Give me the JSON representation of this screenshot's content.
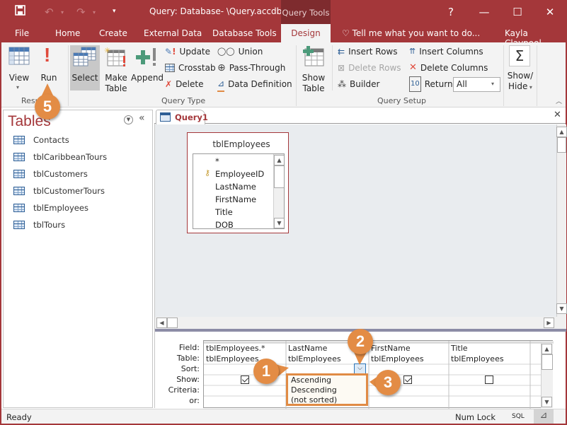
{
  "titlebar": {
    "title": "Query: Database- \\Query.accdb...",
    "context_tab": "Query Tools",
    "help": "?",
    "minimize": "—",
    "maximize": "☐",
    "close": "✕"
  },
  "tabs": [
    {
      "label": "File"
    },
    {
      "label": "Home"
    },
    {
      "label": "Create"
    },
    {
      "label": "External Data"
    },
    {
      "label": "Database Tools"
    },
    {
      "label": "Design",
      "active": true
    }
  ],
  "tell_me": "Tell me what you want to do...",
  "user": "Kayla Claypool",
  "ribbon": {
    "results": {
      "label": "Results",
      "view": "View",
      "run": "Run"
    },
    "query_type": {
      "label": "Query Type",
      "select": "Select",
      "make_table_1": "Make",
      "make_table_2": "Table",
      "append": "Append",
      "update": "Update",
      "crosstab": "Crosstab",
      "delete": "Delete",
      "union": "Union",
      "pass_through": "Pass-Through",
      "data_definition": "Data Definition"
    },
    "query_setup": {
      "label": "Query Setup",
      "show_table_1": "Show",
      "show_table_2": "Table",
      "insert_rows": "Insert Rows",
      "delete_rows": "Delete Rows",
      "builder": "Builder",
      "insert_columns": "Insert Columns",
      "delete_columns": "Delete Columns",
      "return_label": "Return:",
      "return_value": "All"
    },
    "show_hide": {
      "label_1": "Show/",
      "label_2": "Hide"
    }
  },
  "nav": {
    "title": "Tables",
    "items": [
      {
        "label": "Contacts"
      },
      {
        "label": "tblCaribbeanTours"
      },
      {
        "label": "tblCustomers"
      },
      {
        "label": "tblCustomerTours"
      },
      {
        "label": "tblEmployees"
      },
      {
        "label": "tblTours"
      }
    ]
  },
  "document": {
    "tab": "Query1",
    "field_list": {
      "title": "tblEmployees",
      "fields": [
        "*",
        "EmployeeID",
        "LastName",
        "FirstName",
        "Title",
        "DOB"
      ],
      "primary_key": "EmployeeID"
    }
  },
  "design_grid": {
    "row_labels": [
      "Field:",
      "Table:",
      "Sort:",
      "Show:",
      "Criteria:",
      "or:"
    ],
    "columns": [
      {
        "field": "tblEmployees.*",
        "table": "tblEmployees",
        "sort": "",
        "show": true
      },
      {
        "field": "LastName",
        "table": "tblEmployees",
        "sort": "",
        "show": null
      },
      {
        "field": "FirstName",
        "table": "tblEmployees",
        "sort": "",
        "show": true
      },
      {
        "field": "Title",
        "table": "tblEmployees",
        "sort": "",
        "show": false
      }
    ],
    "sort_options": [
      "Ascending",
      "Descending",
      "(not sorted)"
    ]
  },
  "callouts": [
    "1",
    "2",
    "3",
    "5"
  ],
  "status": {
    "left": "Ready",
    "num_lock": "Num Lock",
    "sql": "SQL"
  },
  "colors": {
    "accent": "#a4373a",
    "callout": "#e38c45"
  }
}
